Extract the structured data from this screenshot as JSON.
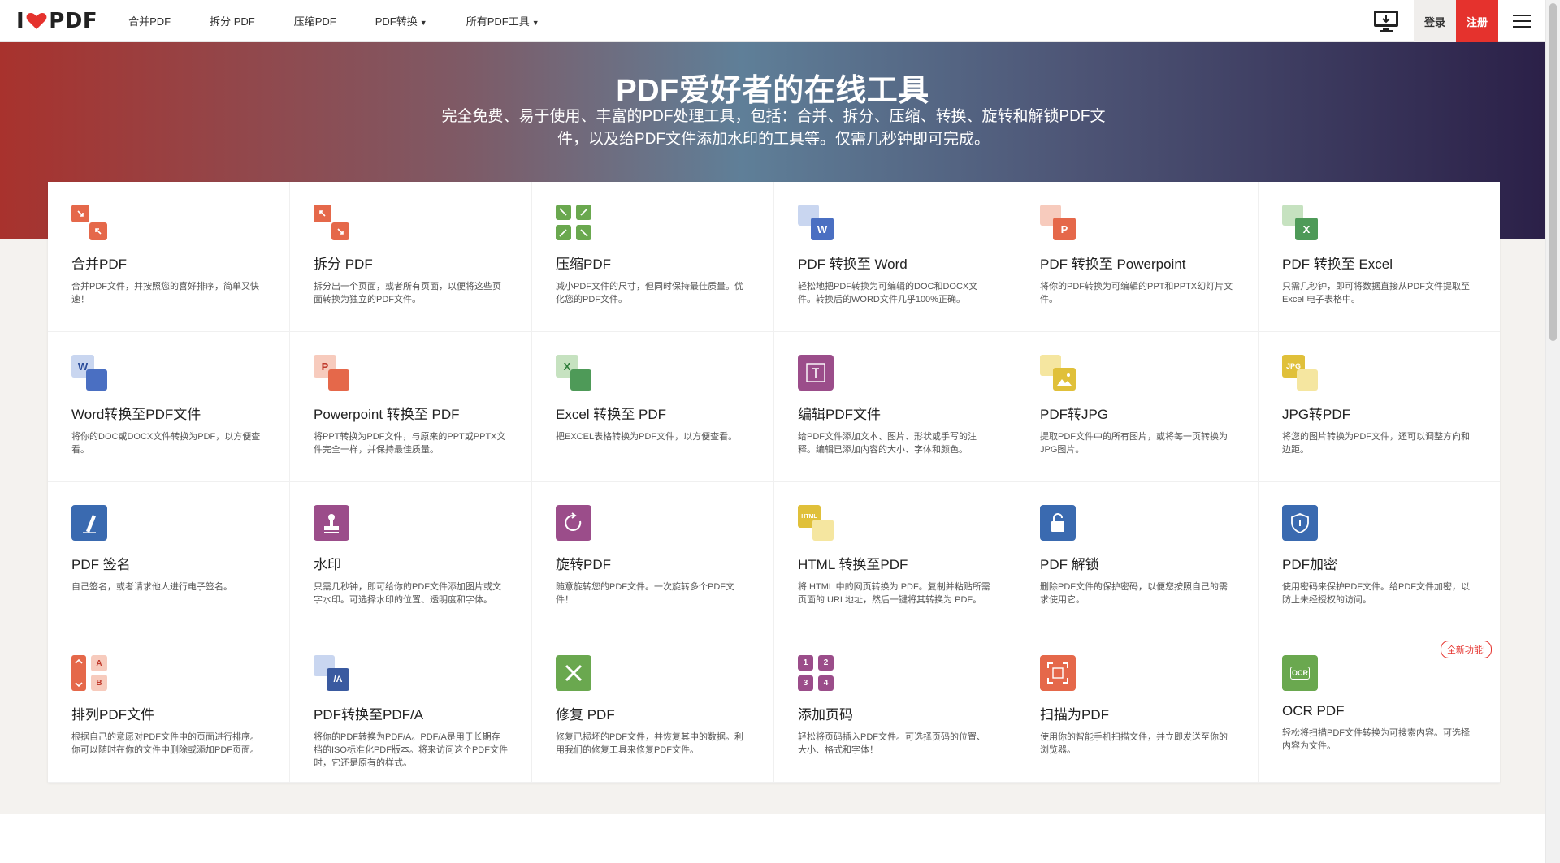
{
  "brand": {
    "logo_left": "I",
    "logo_right": "PDF"
  },
  "nav": [
    {
      "label": "合并PDF",
      "caret": false
    },
    {
      "label": "拆分 PDF",
      "caret": false
    },
    {
      "label": "压缩PDF",
      "caret": false
    },
    {
      "label": "PDF转换",
      "caret": true
    },
    {
      "label": "所有PDF工具",
      "caret": true
    }
  ],
  "header": {
    "login": "登录",
    "signup": "注册",
    "desktop_icon": "desktop-download-icon",
    "menu_icon": "hamburger-menu-icon"
  },
  "hero": {
    "title": "PDF爱好者的在线工具",
    "subtitle": "完全免费、易于使用、丰富的PDF处理工具，包括：合并、拆分、压缩、转换、旋转和解锁PDF文件，以及给PDF文件添加水印的工具等。仅需几秒钟即可完成。"
  },
  "tools": [
    {
      "title": "合并PDF",
      "desc": "合并PDF文件，并按照您的喜好排序，简单又快速！",
      "icon": "merge-icon"
    },
    {
      "title": "拆分 PDF",
      "desc": "拆分出一个页面，或者所有页面，以便将这些页面转换为独立的PDF文件。",
      "icon": "split-icon"
    },
    {
      "title": "压缩PDF",
      "desc": "减小PDF文件的尺寸，但同时保持最佳质量。优化您的PDF文件。",
      "icon": "compress-icon"
    },
    {
      "title": "PDF 转换至 Word",
      "desc": "轻松地把PDF转换为可编辑的DOC和DOCX文件。转换后的WORD文件几乎100%正确。",
      "icon": "pdf-to-word-icon",
      "badge": "W"
    },
    {
      "title": "PDF 转换至 Powerpoint",
      "desc": "将你的PDF转换为可编辑的PPT和PPTX幻灯片文件。",
      "icon": "pdf-to-powerpoint-icon",
      "badge": "P"
    },
    {
      "title": "PDF 转换至 Excel",
      "desc": "只需几秒钟，即可将数据直接从PDF文件提取至Excel 电子表格中。",
      "icon": "pdf-to-excel-icon",
      "badge": "X"
    },
    {
      "title": "Word转换至PDF文件",
      "desc": "将你的DOC或DOCX文件转换为PDF，以方便查看。",
      "icon": "word-to-pdf-icon",
      "badge": "W"
    },
    {
      "title": "Powerpoint 转换至 PDF",
      "desc": "将PPT转换为PDF文件，与原来的PPT或PPTX文件完全一样，并保持最佳质量。",
      "icon": "powerpoint-to-pdf-icon",
      "badge": "P"
    },
    {
      "title": "Excel 转换至 PDF",
      "desc": "把EXCEL表格转换为PDF文件，以方便查看。",
      "icon": "excel-to-pdf-icon",
      "badge": "X"
    },
    {
      "title": "编辑PDF文件",
      "desc": "给PDF文件添加文本、图片、形状或手写的注释。编辑已添加内容的大小、字体和颜色。",
      "icon": "edit-pdf-icon"
    },
    {
      "title": "PDF转JPG",
      "desc": "提取PDF文件中的所有图片，或将每一页转换为JPG图片。",
      "icon": "pdf-to-jpg-icon"
    },
    {
      "title": "JPG转PDF",
      "desc": "将您的图片转换为PDF文件，还可以调整方向和边距。",
      "icon": "jpg-to-pdf-icon",
      "badge": "JPG"
    },
    {
      "title": "PDF 签名",
      "desc": "自己签名，或者请求他人进行电子签名。",
      "icon": "sign-pdf-icon"
    },
    {
      "title": "水印",
      "desc": "只需几秒钟，即可给你的PDF文件添加图片或文字水印。可选择水印的位置、透明度和字体。",
      "icon": "watermark-icon"
    },
    {
      "title": "旋转PDF",
      "desc": "随意旋转您的PDF文件。一次旋转多个PDF文件！",
      "icon": "rotate-pdf-icon"
    },
    {
      "title": "HTML 转换至PDF",
      "desc": "将 HTML 中的网页转换为 PDF。复制并粘贴所需页面的 URL地址，然后一键将其转换为 PDF。",
      "icon": "html-to-pdf-icon",
      "badge": "HTML"
    },
    {
      "title": "PDF 解锁",
      "desc": "删除PDF文件的保护密码，以便您按照自己的需求使用它。",
      "icon": "unlock-pdf-icon"
    },
    {
      "title": "PDF加密",
      "desc": "使用密码来保护PDF文件。给PDF文件加密，以防止未经授权的访问。",
      "icon": "protect-pdf-icon"
    },
    {
      "title": "排列PDF文件",
      "desc": "根据自己的意愿对PDF文件中的页面进行排序。你可以随时在你的文件中删除或添加PDF页面。",
      "icon": "organize-pdf-icon"
    },
    {
      "title": "PDF转换至PDF/A",
      "desc": "将你的PDF转换为PDF/A。PDF/A是用于长期存档的ISO标准化PDF版本。将来访问这个PDF文件时，它还是原有的样式。",
      "icon": "pdf-to-pdfa-icon",
      "badge": "/A"
    },
    {
      "title": "修复 PDF",
      "desc": "修复已损坏的PDF文件，并恢复其中的数据。利用我们的修复工具来修复PDF文件。",
      "icon": "repair-pdf-icon"
    },
    {
      "title": "添加页码",
      "desc": "轻松将页码插入PDF文件。可选择页码的位置、大小、格式和字体！",
      "icon": "page-numbers-icon"
    },
    {
      "title": "扫描为PDF",
      "desc": "使用你的智能手机扫描文件，并立即发送至你的浏览器。",
      "icon": "scan-to-pdf-icon"
    },
    {
      "title": "OCR PDF",
      "desc": "轻松将扫描PDF文件转换为可搜索内容。可选择内容为文件。",
      "icon": "ocr-pdf-icon",
      "badge": "OCR",
      "new_label": "全新功能!"
    }
  ],
  "colors": {
    "red": "#e5322d",
    "orange": "#e5684a",
    "green": "#6aa84f",
    "blue": "#4a6fc2",
    "purple": "#9b4d8a",
    "yellow": "#e0c03a",
    "navy": "#3a6ab0"
  }
}
